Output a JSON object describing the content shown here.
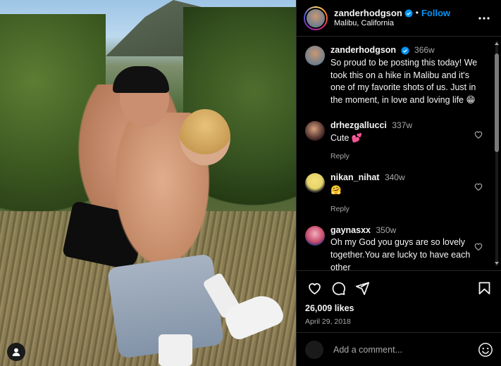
{
  "post": {
    "author": "zanderhodgson",
    "location": "Malibu, California",
    "follow_label": "Follow",
    "dot": "•",
    "verified": true
  },
  "caption": {
    "username": "zanderhodgson",
    "time": "366w",
    "text": "So proud to be posting this today! We took this on a hike in Malibu and it's one of my favorite shots of us. Just in the moment, in love and loving life 😁"
  },
  "comments": [
    {
      "username": "drhezgallucci",
      "time": "337w",
      "text": "Cute 💕",
      "reply_label": "Reply",
      "avatar_color": "#3a2020"
    },
    {
      "username": "nikan_nihat",
      "time": "340w",
      "text": "🤗",
      "reply_label": "Reply",
      "avatar_color": "#e5d36a"
    },
    {
      "username": "gaynasxx",
      "time": "350w",
      "text": "Oh my God you guys are so lovely together.You are lucky to have each other",
      "reply_label": "",
      "avatar_color": "#c84a6a"
    }
  ],
  "engagement": {
    "likes": "26,009 likes",
    "date": "April 29, 2018"
  },
  "add_comment": {
    "placeholder": "Add a comment..."
  },
  "icons": [
    "heart-icon",
    "comment-icon",
    "share-icon",
    "bookmark-icon",
    "more-icon",
    "emoji-icon",
    "user-tag-icon",
    "verified-icon"
  ],
  "colors": {
    "accent": "#0095f6",
    "background": "#000000",
    "muted": "#a8a8a8",
    "border": "#262626"
  }
}
